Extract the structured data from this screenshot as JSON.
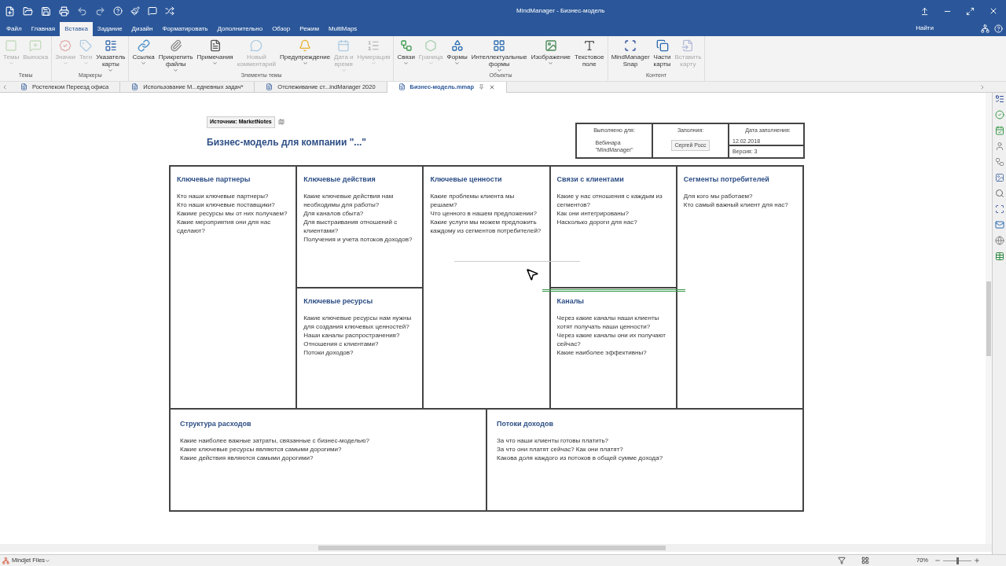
{
  "window": {
    "title": "MindManager - Бизнес-модель"
  },
  "menu_tabs": [
    {
      "label": "Файл",
      "selected": false
    },
    {
      "label": "Главная",
      "selected": false
    },
    {
      "label": "Вставка",
      "selected": true
    },
    {
      "label": "Задание",
      "selected": false
    },
    {
      "label": "Дизайн",
      "selected": false
    },
    {
      "label": "Форматировать",
      "selected": false
    },
    {
      "label": "Дополнительно",
      "selected": false
    },
    {
      "label": "Обзор",
      "selected": false
    },
    {
      "label": "Режим",
      "selected": false
    },
    {
      "label": "MultiMaps",
      "selected": false
    }
  ],
  "search_label": "Найти",
  "ribbon_groups": [
    {
      "label": "Темы",
      "items": [
        {
          "label": "Темы",
          "disabled": true,
          "dropdown": true
        },
        {
          "label": "Выноска",
          "disabled": true,
          "dropdown": false
        }
      ]
    },
    {
      "label": "Маркеры",
      "items": [
        {
          "label": "Значки",
          "disabled": true,
          "dropdown": true
        },
        {
          "label": "Теги",
          "disabled": true,
          "dropdown": true
        },
        {
          "label": "Указатель\nкарты",
          "disabled": false,
          "dropdown": true
        }
      ]
    },
    {
      "label": "Элементы темы",
      "items": [
        {
          "label": "Ссылка",
          "disabled": false,
          "dropdown": true
        },
        {
          "label": "Прикрепить\nфайлы",
          "disabled": false,
          "dropdown": true
        },
        {
          "label": "Примечания",
          "disabled": false,
          "dropdown": true
        },
        {
          "label": "Новый\nкомментарий",
          "disabled": true,
          "dropdown": false
        },
        {
          "label": "Предупреждение",
          "disabled": false,
          "dropdown": true
        },
        {
          "label": "Дата и\nвремя",
          "disabled": true,
          "dropdown": true
        },
        {
          "label": "Нумерация",
          "disabled": true,
          "dropdown": true
        }
      ]
    },
    {
      "label": "Объекты",
      "items": [
        {
          "label": "Связи",
          "disabled": false,
          "dropdown": true
        },
        {
          "label": "Граница",
          "disabled": true,
          "dropdown": true
        },
        {
          "label": "Формы",
          "disabled": false,
          "dropdown": true
        },
        {
          "label": "Интеллектуальные\nформы",
          "disabled": false,
          "dropdown": true
        },
        {
          "label": "Изображение",
          "disabled": false,
          "dropdown": true
        },
        {
          "label": "Текстовое\nполе",
          "disabled": false,
          "dropdown": false
        }
      ]
    },
    {
      "label": "Контент",
      "items": [
        {
          "label": "MindManager\nSnap",
          "disabled": false,
          "dropdown": false
        },
        {
          "label": "Части\nкарты",
          "disabled": false,
          "dropdown": false
        },
        {
          "label": "Вставить\nкарту",
          "disabled": true,
          "dropdown": false
        }
      ]
    }
  ],
  "doc_tabs": [
    {
      "label": "Ростелеком  Переезд офиса",
      "selected": false
    },
    {
      "label": "Использование М...едневных задач*",
      "selected": false
    },
    {
      "label": "Отслеживание ст...indManager 2020",
      "selected": false
    },
    {
      "label": "Бизнес-модель.mmap",
      "selected": true
    }
  ],
  "canvas": {
    "source_label": "Источник: MarketNotes",
    "title": "Бизнес-модель для компании \"...\"",
    "info_table": {
      "done_for_label": "Выполнено для:",
      "done_for": "Вебинара\n\"MindManager\"",
      "filled_by_label": "Заполния:",
      "filled_by": "Сергей Росс",
      "date_label": "Дата заполнения:",
      "date": "12.02.2018",
      "version": "Версия: 3"
    },
    "cells": [
      {
        "title": "Ключевые партнеры",
        "lines": [
          "Кто наши ключевые партнеры?",
          "Кто наши ключевые поставщики?",
          "Какиие ресурсы мы от них получаем?",
          "Какие мероприятия они для нас сделают?"
        ]
      },
      {
        "title": "Ключевые действия",
        "lines": [
          "Какие ключевые действия нам необходимы для работы?",
          "Для каналов сбыта?",
          "Для выстраивания отношений с клиентами?",
          "Получения и учета потоков доходов?"
        ]
      },
      {
        "title": "Ключевые ценности",
        "lines": [
          "Какие проблемы клиента мы решаем?",
          "Что ценного в нашем предложении?",
          "Какие услуги мы можем предложить каждому из сегментов потребителей?"
        ]
      },
      {
        "title": "Связи с клиентами",
        "lines": [
          "Какие у нас отношения с каждым из сегментов?",
          "Как они интегрированы?",
          "Насколько дороги для нас?"
        ]
      },
      {
        "title": "Сегменты потребителей",
        "lines": [
          "Для кого мы работаем?",
          "Кто самый важный клиент для нас?"
        ]
      },
      {
        "title": "Ключевые ресурсы",
        "lines": [
          "Какие ключевые ресурсы нам нужны для создания ключевых ценностей?",
          "Наши каналы распространения?",
          "Отношения с клиентами?",
          "Потоки доходов?"
        ]
      },
      {
        "title": "Каналы",
        "lines": [
          "Через какие каналы наши клиенты хотят получать наши ценности?",
          "Через какие каналы они их получают сейчас?",
          "Какие наиболее эффективны?"
        ]
      },
      {
        "title": "Структура расходов",
        "lines": [
          "Какие наиболее важные затраты, связанные с бизнес-моделью?",
          "Какие ключевые ресурсы являются самыми дорогими?",
          "Какие действия являются самыми дорогими?"
        ]
      },
      {
        "title": "Потоки доходов",
        "lines": [
          "За что наши клиенты готовы платить?",
          "За что они платят сейчас? Как они платят?",
          "Какова доля каждого из потоков в общей сумме дохода?"
        ]
      }
    ]
  },
  "status_bar": {
    "files_label": "Mindjet Files",
    "zoom": "70%",
    "zoom_slider": {
      "level": 0.5
    }
  }
}
